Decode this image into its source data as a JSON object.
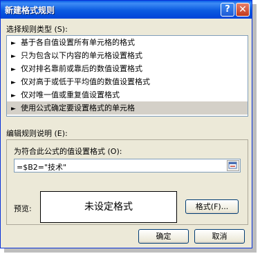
{
  "window": {
    "title": "新建格式规则",
    "help_label": "?",
    "close_label": "✕"
  },
  "rule_type": {
    "label": "选择规则类型",
    "accel": "(S):",
    "items": [
      {
        "label": "基于各自值设置所有单元格的格式"
      },
      {
        "label": "只为包含以下内容的单元格设置格式"
      },
      {
        "label": "仅对排名靠前或靠后的数值设置格式"
      },
      {
        "label": "仅对高于或低于平均值的数值设置格式"
      },
      {
        "label": "仅对唯一值或重复值设置格式"
      },
      {
        "label": "使用公式确定要设置格式的单元格"
      }
    ],
    "selected_index": 5
  },
  "edit": {
    "label": "编辑规则说明",
    "accel": "(E):",
    "formula_label": "为符合此公式的值设置格式",
    "formula_accel": "(O):",
    "formula_value": "=$B2=\"技术\"",
    "preview_label": "预览:",
    "preview_text": "未设定格式",
    "format_button": "格式(F)..."
  },
  "buttons": {
    "ok": "确定",
    "cancel": "取消"
  },
  "colors": {
    "titlebar": "#0a5fe8",
    "dialog_bg": "#ece9d8",
    "selected_item": "#d4d0c8"
  }
}
